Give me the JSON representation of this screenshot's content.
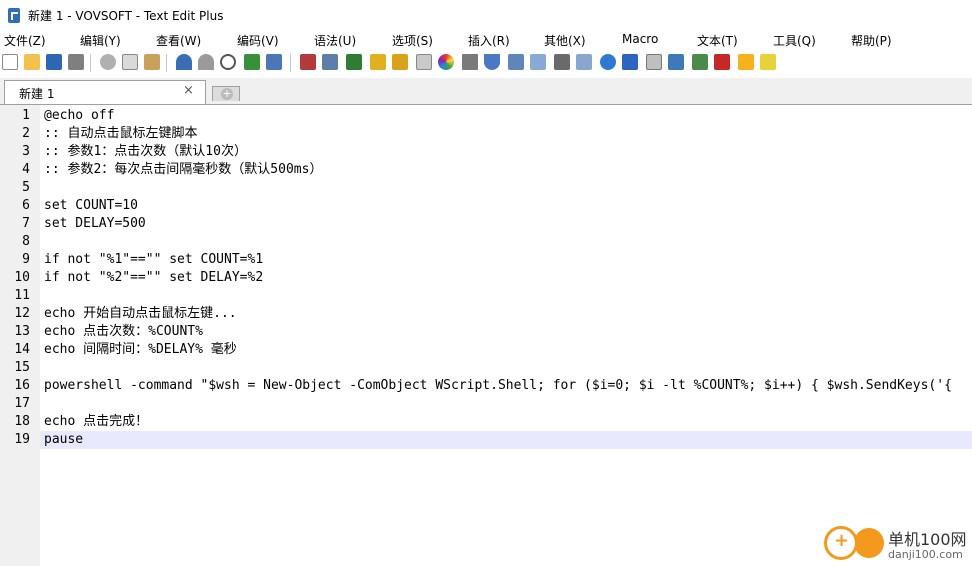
{
  "window": {
    "title": "新建 1 - VOVSOFT - Text Edit Plus"
  },
  "menu": [
    {
      "label": "文件(Z)"
    },
    {
      "label": "编辑(Y)"
    },
    {
      "label": "查看(W)"
    },
    {
      "label": "编码(V)"
    },
    {
      "label": "语法(U)"
    },
    {
      "label": "选项(S)"
    },
    {
      "label": "插入(R)"
    },
    {
      "label": "其他(X)"
    },
    {
      "label": "Macro"
    },
    {
      "label": "文本(T)"
    },
    {
      "label": "工具(Q)"
    },
    {
      "label": "帮助(P)"
    }
  ],
  "toolbar": {
    "icons": [
      "new-file-icon",
      "open-folder-icon",
      "save-icon",
      "print-icon",
      "cut-icon",
      "copy-icon",
      "paste-icon",
      "undo-icon",
      "redo-icon",
      "find-icon",
      "replace-icon",
      "goto-icon",
      "book-icon",
      "monitor-icon",
      "chart-icon",
      "lock-icon",
      "lock-alt-icon",
      "document-icon",
      "color-wheel-icon",
      "pen-icon",
      "filter-icon",
      "window-icon",
      "mail-icon",
      "list-icon",
      "keyboard-icon",
      "arrows-horizontal-icon",
      "arrows-vertical-icon",
      "copy-window-icon",
      "text-tool-icon",
      "text-tool-alt-icon",
      "calendar-icon",
      "warning-icon",
      "note-icon"
    ]
  },
  "tabs": {
    "active_label": "新建 1",
    "close_glyph": "×",
    "new_glyph": "+"
  },
  "editor": {
    "lines": [
      "@echo off",
      ":: 自动点击鼠标左键脚本",
      ":: 参数1：点击次数（默认10次）",
      ":: 参数2：每次点击间隔毫秒数（默认500ms）",
      "",
      "set COUNT=10",
      "set DELAY=500",
      "",
      "if not \"%1\"==\"\" set COUNT=%1",
      "if not \"%2\"==\"\" set DELAY=%2",
      "",
      "echo 开始自动点击鼠标左键...",
      "echo 点击次数：%COUNT%",
      "echo 间隔时间：%DELAY% 毫秒",
      "",
      "powershell -command \"$wsh = New-Object -ComObject WScript.Shell; for ($i=0; $i -lt %COUNT%; $i++) { $wsh.SendKeys('{",
      "",
      "echo 点击完成！",
      "pause"
    ],
    "line_numbers": [
      "1",
      "2",
      "3",
      "4",
      "5",
      "6",
      "7",
      "8",
      "9",
      "10",
      "11",
      "12",
      "13",
      "14",
      "15",
      "16",
      "17",
      "18",
      "19"
    ],
    "current_line": 19
  },
  "watermark": {
    "text": "单机100网",
    "sub": "danji100.com"
  }
}
